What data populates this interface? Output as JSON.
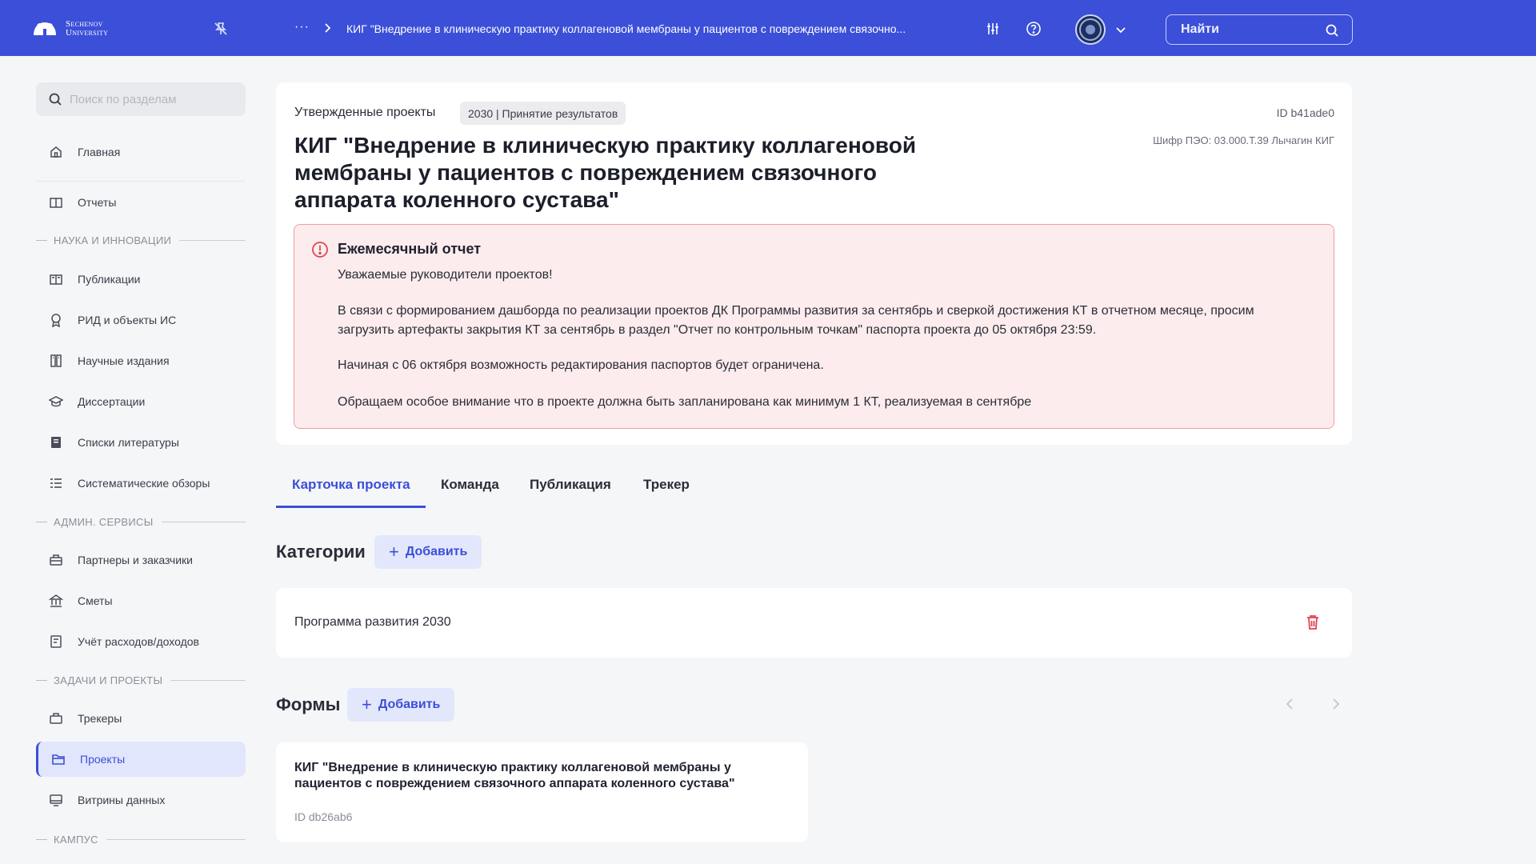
{
  "topbar": {
    "logo_text_line1": "Sechenov",
    "logo_text_line2": "University",
    "breadcrumb_dots": "···",
    "breadcrumb_title": "КИГ \"Внедрение в клиническую практику коллагеновой мембраны у пациентов с повреждением связочно...",
    "search_label": "Найти",
    "colors": {
      "background": "#3b4fd8"
    }
  },
  "sidebar": {
    "search_placeholder": "Поиск по разделам",
    "items_top": [
      {
        "label": "Главная",
        "icon": "home-icon"
      },
      {
        "label": "Отчеты",
        "icon": "book-icon"
      }
    ],
    "sections": [
      {
        "title": "НАУКА И ИННОВАЦИИ",
        "items": [
          {
            "label": "Публикации",
            "icon": "book-open-icon"
          },
          {
            "label": "РИД и объекты ИС",
            "icon": "award-icon"
          },
          {
            "label": "Научные издания",
            "icon": "journal-icon"
          },
          {
            "label": "Диссертации",
            "icon": "graduation-cap-icon"
          },
          {
            "label": "Списки литературы",
            "icon": "list-book-icon"
          },
          {
            "label": "Систематические обзоры",
            "icon": "review-list-icon"
          }
        ]
      },
      {
        "title": "АДМИН. СЕРВИСЫ",
        "items": [
          {
            "label": "Партнеры и заказчики",
            "icon": "briefcase-icon"
          },
          {
            "label": "Сметы",
            "icon": "bank-icon"
          },
          {
            "label": "Учёт расходов/доходов",
            "icon": "ledger-icon"
          }
        ]
      },
      {
        "title": "ЗАДАЧИ И ПРОЕКТЫ",
        "items": [
          {
            "label": "Трекеры",
            "icon": "tracker-icon"
          },
          {
            "label": "Проекты",
            "icon": "folder-icon",
            "active": true
          },
          {
            "label": "Витрины данных",
            "icon": "monitor-icon"
          }
        ]
      },
      {
        "title": "КАМПУС",
        "items": []
      }
    ]
  },
  "project": {
    "status_label": "Утвержденные проекты",
    "badge": "2030 | Принятие результатов",
    "id": "ID b41ade0",
    "cipher": "Шифр ПЭО: 03.000.Т.39 Лычагин КИГ",
    "title": "КИГ \"Внедрение в клиническую практику коллагеновой мембраны у пациентов с повреждением связочного аппарата коленного сустава\""
  },
  "alert": {
    "title": "Ежемесячный отчет",
    "greeting": "Уважаемые руководители проектов!",
    "paragraph1": "В связи с формированием дашборда по реализации проектов ДК Программы развития за сентябрь и сверкой достижения КТ в отчетном месяце, просим загрузить артефакты закрытия КТ за сентябрь в раздел \"Отчет по контрольным точкам\" паспорта проекта до 05 октября 23:59.",
    "paragraph2": "Начиная с 06 октября возможность редактирования паспортов будет ограничена.",
    "paragraph3": "Обращаем особое внимание что в проекте должна быть запланирована как минимум 1 КТ, реализуемая в сентябре",
    "colors": {
      "background": "#fdeced",
      "border": "#ee9ea2",
      "icon": "#e0454d"
    }
  },
  "tabs": [
    {
      "label": "Карточка проекта",
      "active": true
    },
    {
      "label": "Команда"
    },
    {
      "label": "Публикация"
    },
    {
      "label": "Трекер"
    }
  ],
  "categories": {
    "title": "Категории",
    "add_label": "Добавить",
    "items": [
      "Программа развития 2030"
    ]
  },
  "forms": {
    "title": "Формы",
    "add_label": "Добавить",
    "items": [
      {
        "title": "КИГ \"Внедрение в клиническую практику коллагеновой мембраны у пациентов с повреждением связочного аппарата коленного сустава\"",
        "id": "ID db26ab6"
      }
    ]
  },
  "accent_color": "#3b4fd8"
}
